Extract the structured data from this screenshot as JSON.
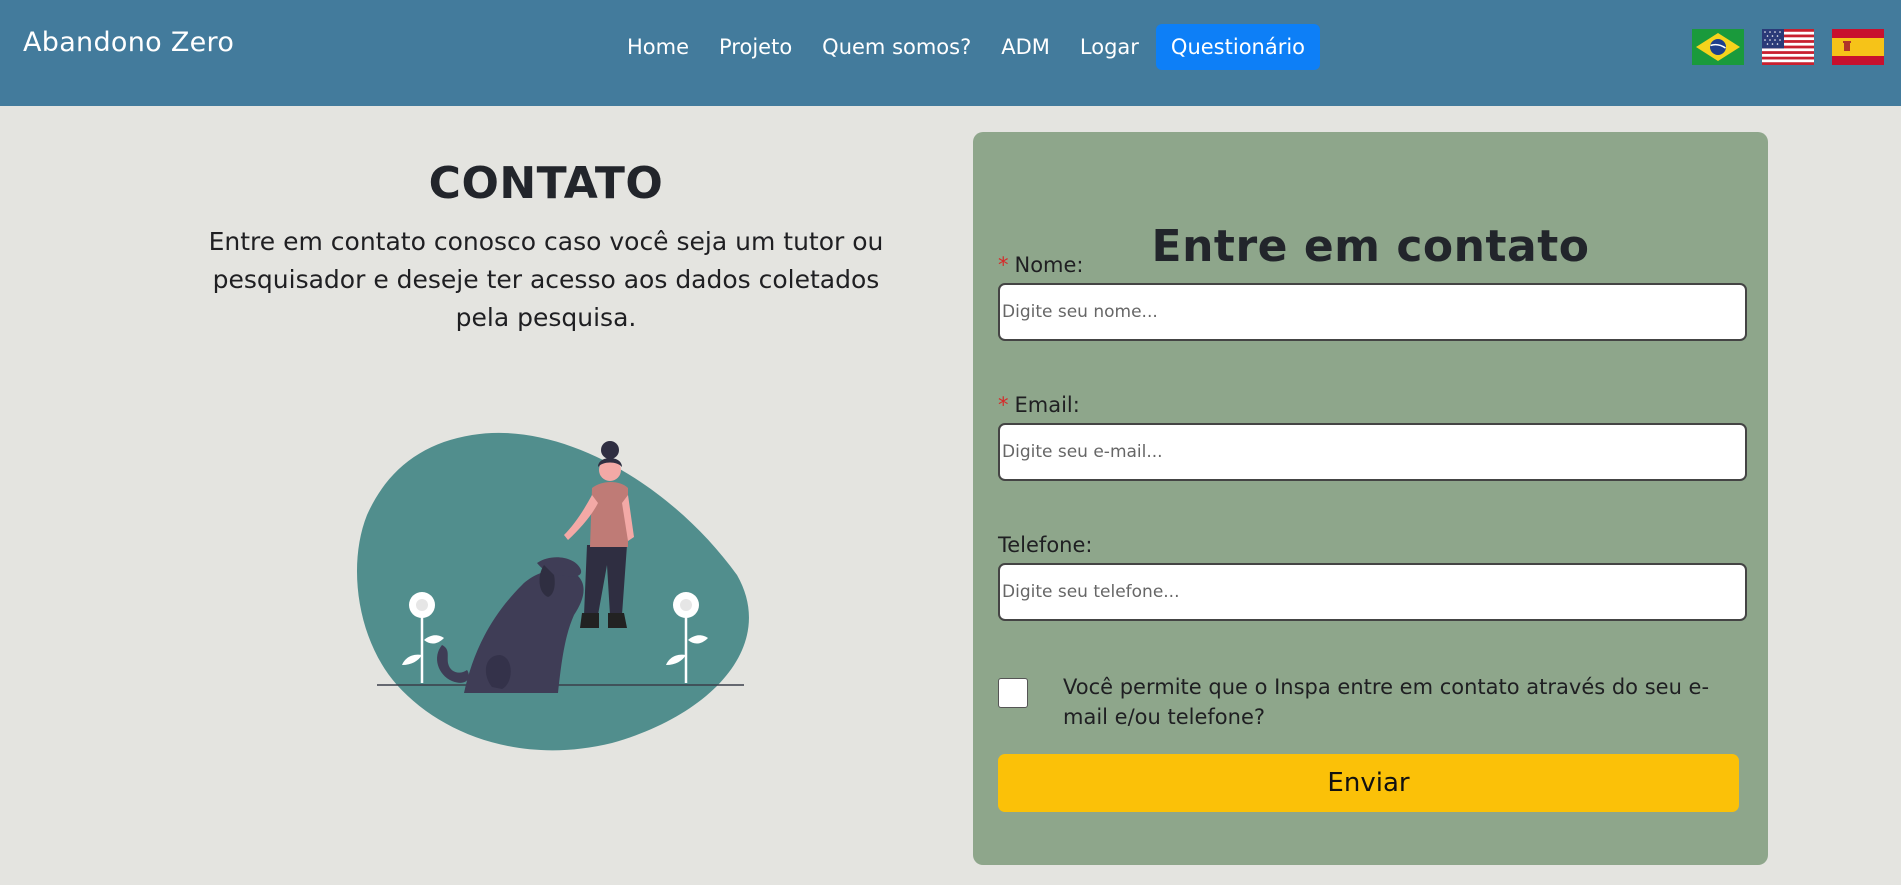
{
  "navbar": {
    "brand": "Abandono Zero",
    "links": [
      {
        "label": "Home"
      },
      {
        "label": "Projeto"
      },
      {
        "label": "Quem somos?"
      },
      {
        "label": "ADM"
      },
      {
        "label": "Logar"
      },
      {
        "label": "Questionário",
        "active": true
      }
    ],
    "flags": [
      "brazil-flag-icon",
      "usa-flag-icon",
      "spain-flag-icon"
    ],
    "background_color": "#437b9c",
    "active_color": "#0d7ff7"
  },
  "main": {
    "title": "CONTATO",
    "intro": "Entre em contato conosco caso você seja um tutor ou pesquisador e deseje ter acesso aos dados coletados pela pesquisa.",
    "illustration": "woman-petting-dog-illustration"
  },
  "form": {
    "title": "Entre em contato",
    "required_marker": "*",
    "name_label": "Nome:",
    "name_placeholder": "Digite seu nome...",
    "email_label": "Email:",
    "email_placeholder": "Digite seu e-mail...",
    "phone_label": "Telefone:",
    "phone_placeholder": "Digite seu telefone...",
    "consent_text": "Você permite que o Inspa entre em contato através do seu e-mail e/ou telefone?",
    "consent_checked": false,
    "submit_label": "Enviar",
    "card_color": "#8ea68b",
    "submit_color": "#fbc108"
  }
}
